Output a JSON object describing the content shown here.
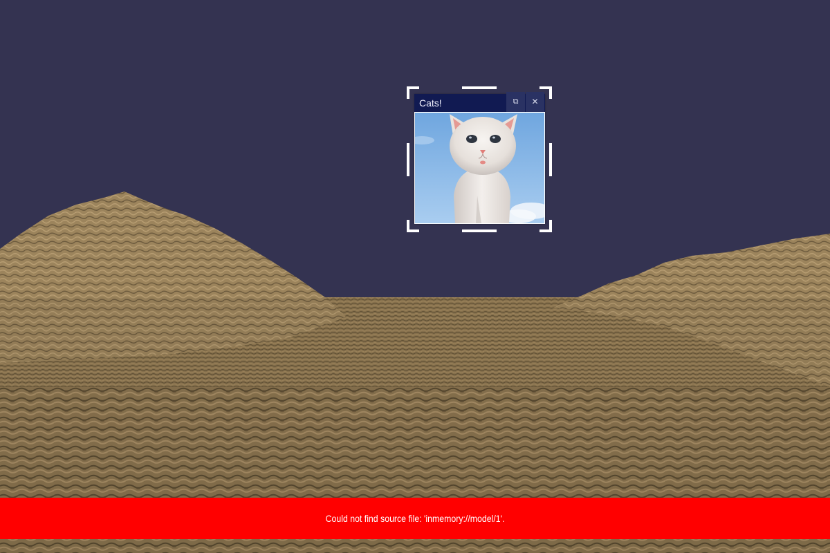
{
  "scene": {
    "sky_color": "#343351",
    "ground_color": "#8a7450",
    "ground_dark_color": "#3f3420",
    "ground_light_color": "#c4a679"
  },
  "window": {
    "title": "Cats!",
    "titlebar_color": "#111a52",
    "restore_icon": "restore-icon",
    "restore_glyph": "⧉",
    "close_icon": "close-icon",
    "close_glyph": "✕",
    "image_subject": "kitten-photo"
  },
  "error": {
    "message": "Could not find source file: 'inmemory://model/1'.",
    "color": "#ff0000"
  }
}
